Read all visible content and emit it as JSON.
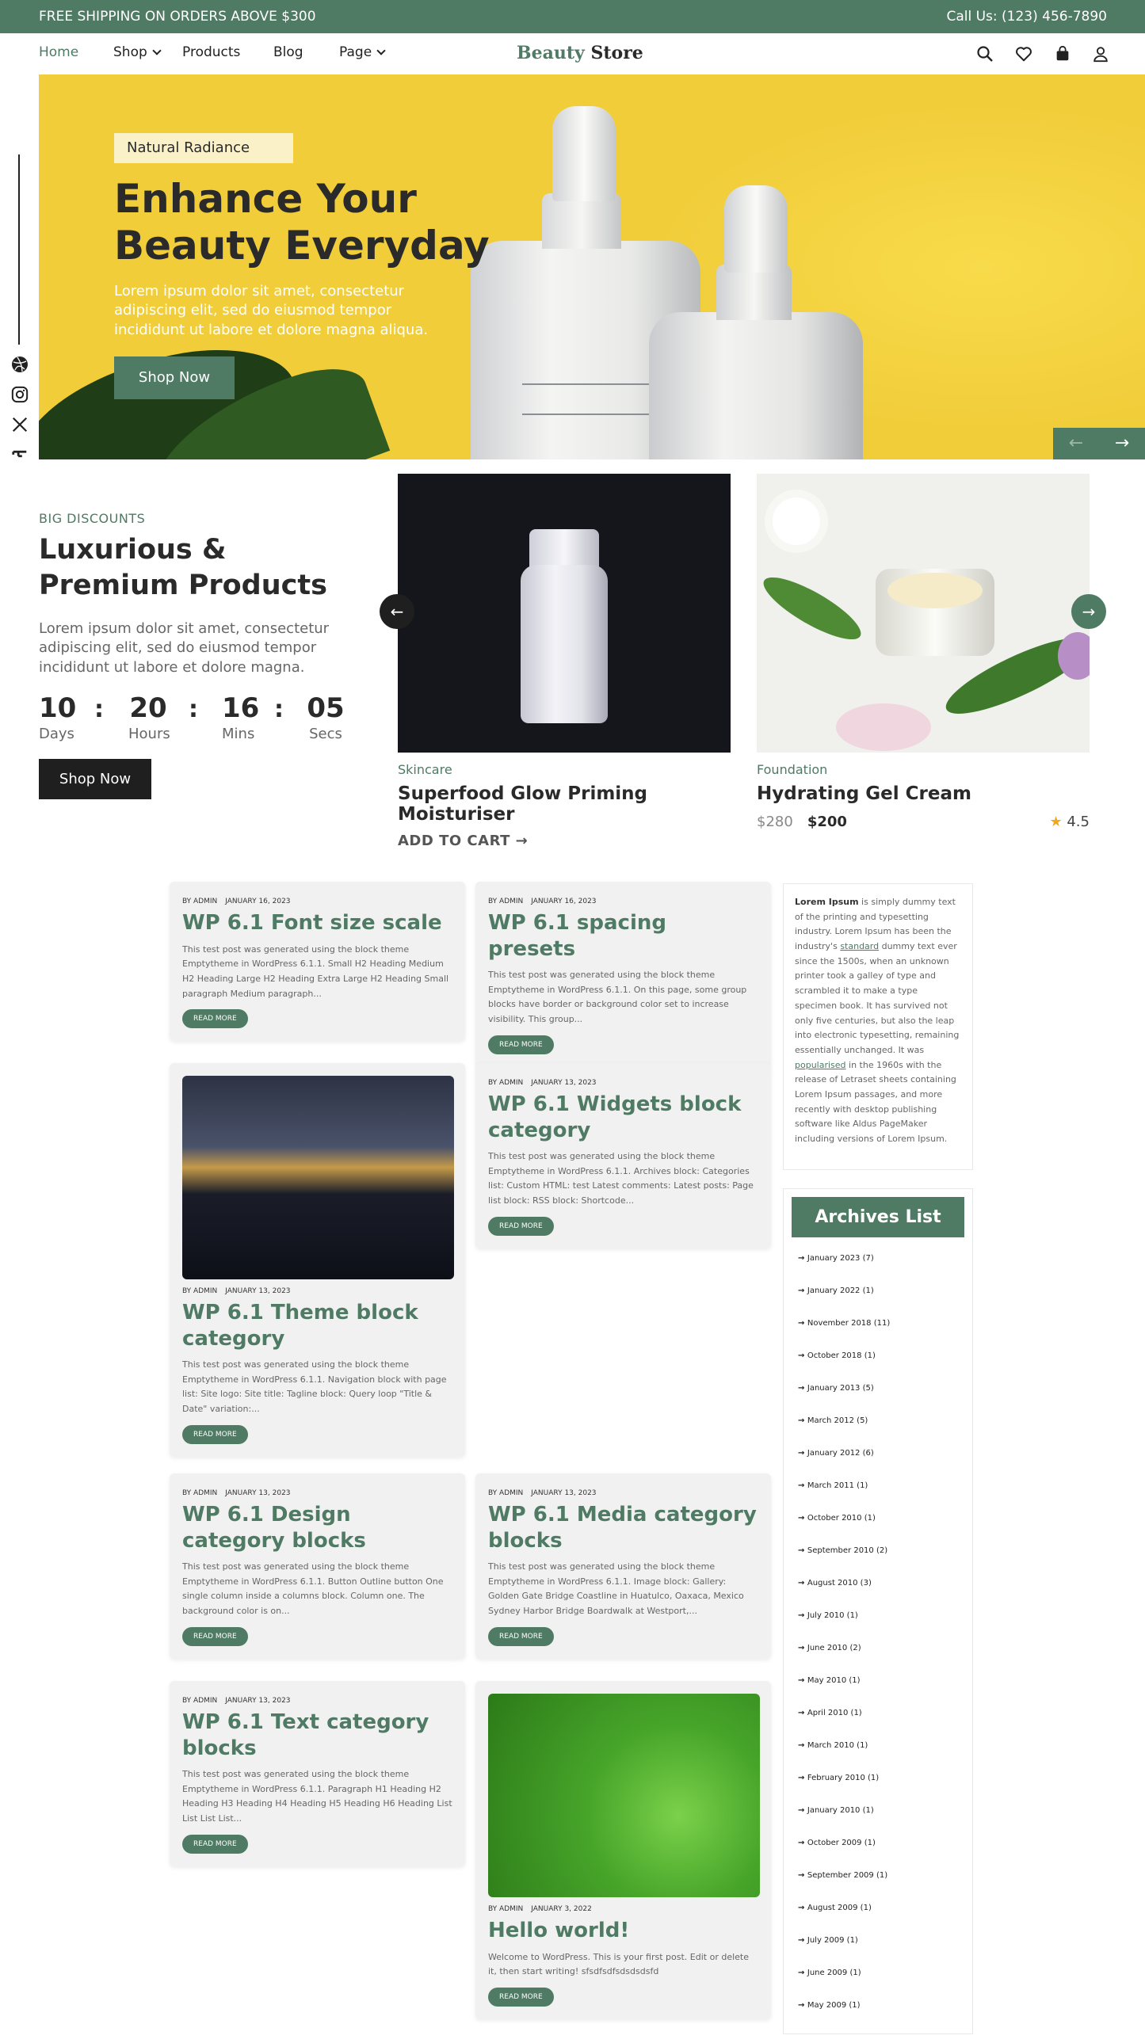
{
  "topbar": {
    "left": "FREE SHIPPING ON ORDERS ABOVE $300",
    "right": "Call Us: (123) 456-7890"
  },
  "nav": {
    "items": [
      "Home",
      "Shop",
      "Products",
      "Blog",
      "Page"
    ],
    "logo_a": "Beauty",
    "logo_b": "Store"
  },
  "hero": {
    "badge": "Natural Radiance",
    "title": "Enhance Your Beauty Everyday",
    "text": "Lorem ipsum dolor sit amet, consectetur adipiscing elit, sed do eiusmod tempor incididunt ut labore et dolore magna aliqua.",
    "button": "Shop Now",
    "prev": "←",
    "next": "→"
  },
  "discounts": {
    "tag": "BIG DISCOUNTS",
    "title": "Luxurious & Premium Products",
    "text": "Lorem ipsum dolor sit amet, consectetur adipiscing elit, sed do eiusmod tempor incididunt ut labore et dolore magna.",
    "countdown": [
      {
        "value": "10",
        "label": "Days"
      },
      {
        "value": "20",
        "label": "Hours"
      },
      {
        "value": "16",
        "label": "Mins"
      },
      {
        "value": "05",
        "label": "Secs"
      }
    ],
    "colon": ":",
    "button": "Shop Now"
  },
  "products": [
    {
      "category": "Skincare",
      "name": "Superfood Glow Priming Moisturiser",
      "cta": "ADD TO CART →"
    },
    {
      "category": "Foundation",
      "name": "Hydrating Gel Cream",
      "old_price": "$280",
      "price": "$200",
      "rating": "4.5"
    }
  ],
  "carousel": {
    "prev": "←",
    "next": "→"
  },
  "posts": [
    {
      "author": "BY ADMIN",
      "date": "JANUARY 16, 2023",
      "title": "WP 6.1 Font size scale",
      "excerpt": "This test post was generated using the block theme Emptytheme in WordPress 6.1.1. Small H2 Heading Medium H2 Heading Large H2 Heading Extra Large H2 Heading Small paragraph Medium paragraph...",
      "button": "READ MORE"
    },
    {
      "author": "BY ADMIN",
      "date": "JANUARY 16, 2023",
      "title": "WP 6.1 spacing presets",
      "excerpt": "This test post was generated using the block theme Emptytheme in WordPress 6.1.1. On this page, some group blocks have border or background color set to increase visibility. This group...",
      "button": "READ MORE"
    },
    {
      "author": "BY ADMIN",
      "date": "JANUARY 13, 2023",
      "title": "WP 6.1 Theme block category",
      "excerpt": "This test post was generated using the block theme Emptytheme in WordPress 6.1.1. Navigation block with page list: Site logo: Site title: Tagline block: Query loop \"Title & Date\" variation:...",
      "button": "READ MORE"
    },
    {
      "author": "BY ADMIN",
      "date": "JANUARY 13, 2023",
      "title": "WP 6.1 Widgets block category",
      "excerpt": "This test post was generated using the block theme Emptytheme in WordPress 6.1.1. Archives block: Categories list: Custom HTML: test Latest comments: Latest posts: Page list block: RSS block: Shortcode...",
      "button": "READ MORE"
    },
    {
      "author": "BY ADMIN",
      "date": "JANUARY 13, 2023",
      "title": "WP 6.1 Design category blocks",
      "excerpt": "This test post was generated using the block theme Emptytheme in WordPress 6.1.1. Button Outline button One single column inside a columns block. Column one. The background color is on...",
      "button": "READ MORE"
    },
    {
      "author": "BY ADMIN",
      "date": "JANUARY 13, 2023",
      "title": "WP 6.1 Media category blocks",
      "excerpt": "This test post was generated using the block theme Emptytheme in WordPress 6.1.1. Image block: Gallery: Golden Gate Bridge Coastline in Huatulco, Oaxaca, Mexico Sydney Harbor Bridge Boardwalk at Westport,...",
      "button": "READ MORE"
    },
    {
      "author": "BY ADMIN",
      "date": "JANUARY 13, 2023",
      "title": "WP 6.1 Text category blocks",
      "excerpt": "This test post was generated using the block theme Emptytheme in WordPress 6.1.1. Paragraph H1 Heading H2 Heading H3 Heading H4 Heading H5 Heading H6 Heading List List List List...",
      "button": "READ MORE"
    },
    {
      "author": "BY ADMIN",
      "date": "JANUARY 3, 2022",
      "title": "Hello world!",
      "excerpt": "Welcome to WordPress. This is your first post. Edit or delete it, then start writing! sfsdfsdfsdsdsdsfd",
      "button": "READ MORE"
    }
  ],
  "about": {
    "lead": "Lorem Ipsum",
    "t1": " is simply dummy text of the printing and typesetting industry. Lorem Ipsum has been the industry's ",
    "link1": "standard",
    "t2": " dummy text ever since the 1500s, when an unknown printer took a galley of type and scrambled it to make a type specimen book. It has survived not only five centuries, but also the leap into electronic typesetting, remaining essentially unchanged. It was ",
    "link2": "popularised",
    "t3": " in the 1960s with the release of Letraset sheets containing Lorem Ipsum passages, and more recently with desktop publishing software like Aldus PageMaker including versions of Lorem Ipsum."
  },
  "archives": {
    "title": "Archives List",
    "items": [
      "January 2023 (7)",
      "January 2022 (1)",
      "November 2018 (11)",
      "October 2018 (1)",
      "January 2013 (5)",
      "March 2012 (5)",
      "January 2012 (6)",
      "March 2011 (1)",
      "October 2010 (1)",
      "September 2010 (2)",
      "August 2010 (3)",
      "July 2010 (1)",
      "June 2010 (2)",
      "May 2010 (1)",
      "April 2010 (1)",
      "March 2010 (1)",
      "February 2010 (1)",
      "January 2010 (1)",
      "October 2009 (1)",
      "September 2009 (1)",
      "August 2009 (1)",
      "July 2009 (1)",
      "June 2009 (1)",
      "May 2009 (1)"
    ]
  },
  "colors": {
    "accent": "#4f7a64",
    "hero_bg": "#f1cd3a",
    "dark": "#1f1f1f",
    "star": "#f0a91e"
  }
}
